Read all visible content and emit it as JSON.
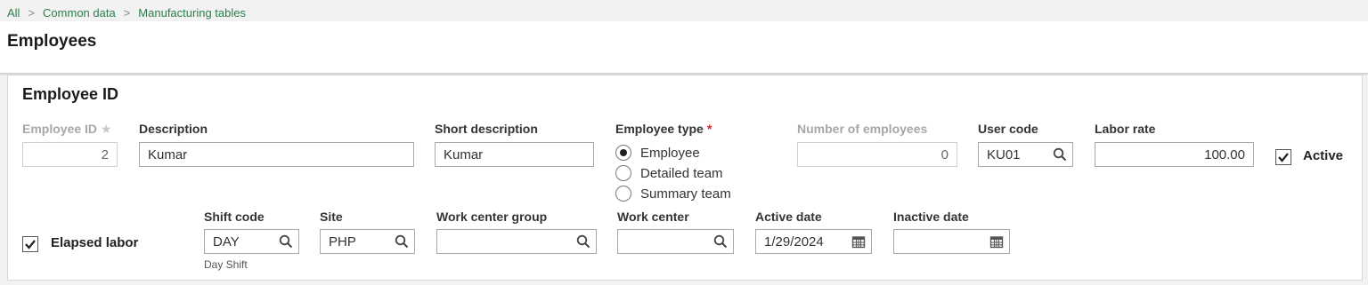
{
  "breadcrumb": {
    "items": [
      "All",
      "Common data",
      "Manufacturing tables"
    ],
    "separator": ">"
  },
  "page": {
    "title": "Employees"
  },
  "section": {
    "title": "Employee ID"
  },
  "form": {
    "employee_id": {
      "label": "Employee ID",
      "value": "2"
    },
    "description": {
      "label": "Description",
      "value": "Kumar"
    },
    "short_description": {
      "label": "Short description",
      "value": "Kumar"
    },
    "employee_type": {
      "label": "Employee type",
      "required_mark": "*",
      "options": [
        "Employee",
        "Detailed team",
        "Summary team"
      ],
      "selected": "Employee"
    },
    "number_of_employees": {
      "label": "Number of employees",
      "value": "0"
    },
    "user_code": {
      "label": "User code",
      "value": "KU01"
    },
    "labor_rate": {
      "label": "Labor rate",
      "value": "100.00"
    },
    "active": {
      "label": "Active",
      "checked": true
    },
    "elapsed_labor": {
      "label": "Elapsed labor",
      "checked": true
    },
    "shift_code": {
      "label": "Shift code",
      "value": "DAY",
      "description": "Day Shift"
    },
    "site": {
      "label": "Site",
      "value": "PHP"
    },
    "work_center_group": {
      "label": "Work center group",
      "value": ""
    },
    "work_center": {
      "label": "Work center",
      "value": ""
    },
    "active_date": {
      "label": "Active date",
      "value": "1/29/2024"
    },
    "inactive_date": {
      "label": "Inactive date",
      "value": ""
    }
  },
  "colors": {
    "breadcrumb": "#2e7d4f",
    "required": "#dd2222"
  },
  "icons": {
    "lookup": "search-icon",
    "date": "calendar-icon",
    "check": "checkmark-icon"
  }
}
